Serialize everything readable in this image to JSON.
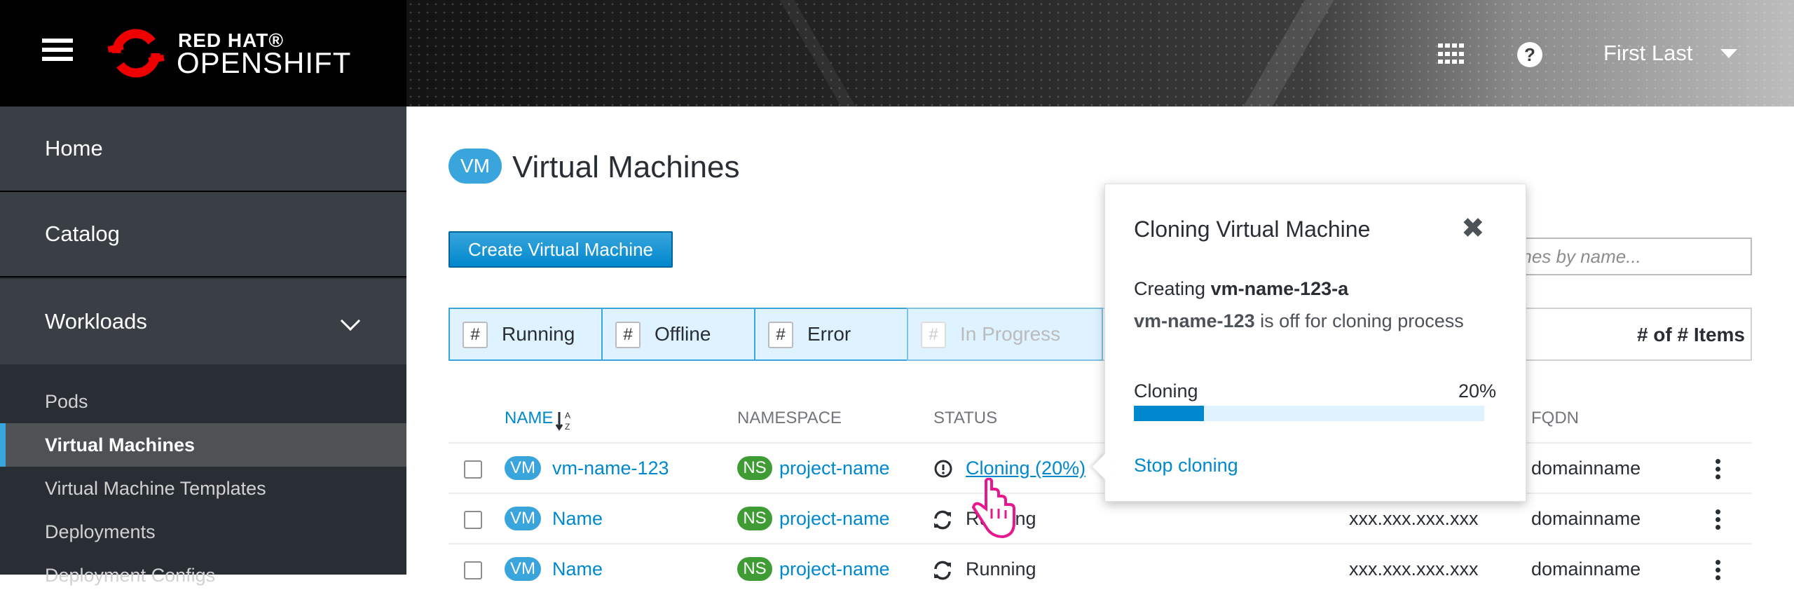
{
  "masthead": {
    "brand_top": "RED HAT®",
    "brand_bottom": "OPENSHIFT",
    "menu_icon": "hamburger-icon",
    "apps_icon": "grid-icon",
    "help_icon": "question-circle-icon",
    "help_glyph": "?",
    "user_name": "First Last"
  },
  "sidebar": {
    "home": "Home",
    "catalog": "Catalog",
    "workloads": "Workloads",
    "sub_items": [
      "Pods",
      "Virtual Machines",
      "Virtual Machine Templates",
      "Deployments",
      "Deployment Configs"
    ],
    "active_item": "Virtual Machines"
  },
  "page": {
    "title_badge": "VM",
    "title": "Virtual Machines",
    "create_button": "Create Virtual Machine",
    "search_placeholder": "Machines by name..."
  },
  "filters": {
    "chips": [
      {
        "count": "#",
        "label": "Running"
      },
      {
        "count": "#",
        "label": "Offline"
      },
      {
        "count": "#",
        "label": "Error"
      },
      {
        "count": "#",
        "label": "In Progress"
      }
    ],
    "items_count": "# of # Items"
  },
  "table": {
    "columns": {
      "name": "NAME",
      "namespace": "NAMESPACE",
      "status": "STATUS",
      "fqdn": "FQDN"
    },
    "rows": [
      {
        "badge": "VM",
        "name": "vm-name-123",
        "ns_badge": "NS",
        "namespace": "project-name",
        "status": "Cloning (20%)",
        "ip": "",
        "fqdn": "domainname"
      },
      {
        "badge": "VM",
        "name": "Name",
        "ns_badge": "NS",
        "namespace": "project-name",
        "status": "Running",
        "ip": "xxx.xxx.xxx.xxx",
        "fqdn": "domainname"
      },
      {
        "badge": "VM",
        "name": "Name",
        "ns_badge": "NS",
        "namespace": "project-name",
        "status": "Running",
        "ip": "xxx.xxx.xxx.xxx",
        "fqdn": "domainname"
      }
    ]
  },
  "popover": {
    "title": "Cloning Virtual Machine",
    "close_glyph": "✖",
    "creating_prefix": "Creating ",
    "creating_name": "vm-name-123-a",
    "source_name": "vm-name-123",
    "source_suffix": " is off for cloning process",
    "progress_label": "Cloning",
    "progress_text": "20%",
    "progress_value": 0.2,
    "stop_link": "Stop cloning"
  },
  "colors": {
    "accent": "#0088ce",
    "vm_badge": "#39a5dc",
    "ns_badge": "#3f9c35",
    "nav_bg": "#292e34",
    "cursor": "#e6178f"
  }
}
